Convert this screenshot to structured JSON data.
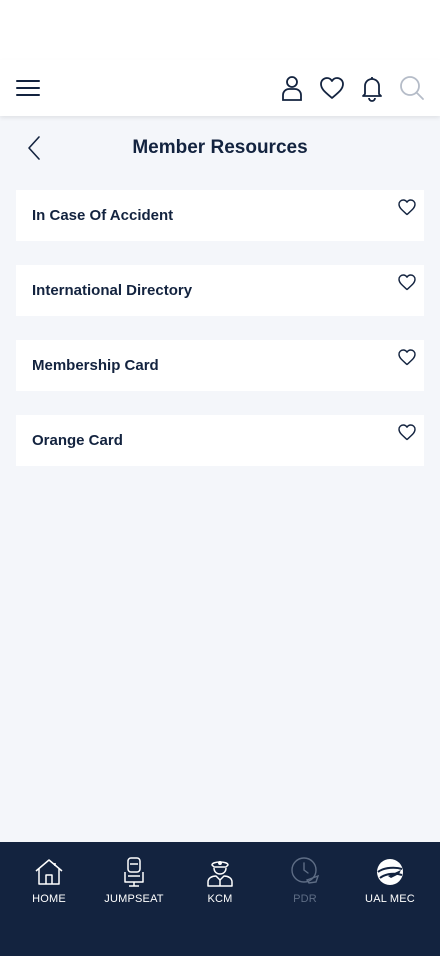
{
  "page": {
    "title": "Member Resources"
  },
  "resources": [
    {
      "label": "In Case Of Accident"
    },
    {
      "label": "International Directory"
    },
    {
      "label": "Membership Card"
    },
    {
      "label": "Orange Card"
    }
  ],
  "bottom_nav": [
    {
      "label": "HOME",
      "icon": "home-icon"
    },
    {
      "label": "JUMPSEAT",
      "icon": "seat-icon"
    },
    {
      "label": "KCM",
      "icon": "pilot-icon"
    },
    {
      "label": "PDR",
      "icon": "clock-plane-icon",
      "disabled": true
    },
    {
      "label": "UAL MEC",
      "icon": "globe-plane-icon"
    }
  ],
  "colors": {
    "navy": "#13233f",
    "background": "#f4f6fa",
    "disabled": "#5e6d85",
    "search_icon": "#b5bcc8"
  }
}
